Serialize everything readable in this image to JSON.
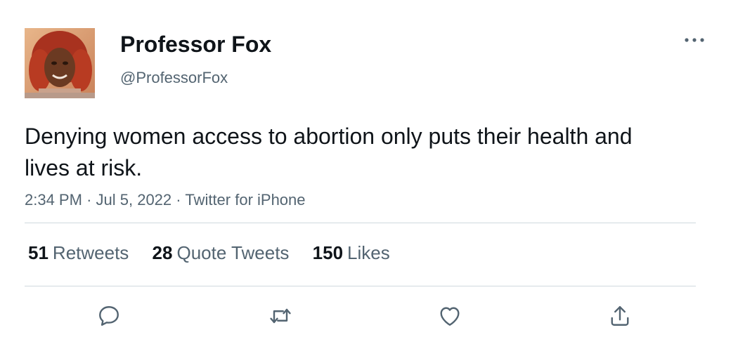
{
  "user": {
    "display_name": "Professor Fox",
    "handle": "@ProfessorFox",
    "avatar_icon": "profile-photo"
  },
  "more_icon": "more-horizontal-icon",
  "tweet": {
    "text": "Denying women access to abortion only puts their health and lives at risk."
  },
  "meta": {
    "time": "2:34 PM",
    "separator": "·",
    "date": "Jul 5, 2022",
    "source": "Twitter for iPhone"
  },
  "stats": {
    "retweets": {
      "count": "51",
      "label": "Retweets"
    },
    "quotes": {
      "count": "28",
      "label": "Quote Tweets"
    },
    "likes": {
      "count": "150",
      "label": "Likes"
    }
  },
  "actions": {
    "reply_icon": "reply-icon",
    "retweet_icon": "retweet-icon",
    "like_icon": "heart-icon",
    "share_icon": "share-icon"
  },
  "colors": {
    "primary_text": "#0f1419",
    "secondary_text": "#536471",
    "divider": "#cfd9de",
    "icon": "#536471"
  }
}
